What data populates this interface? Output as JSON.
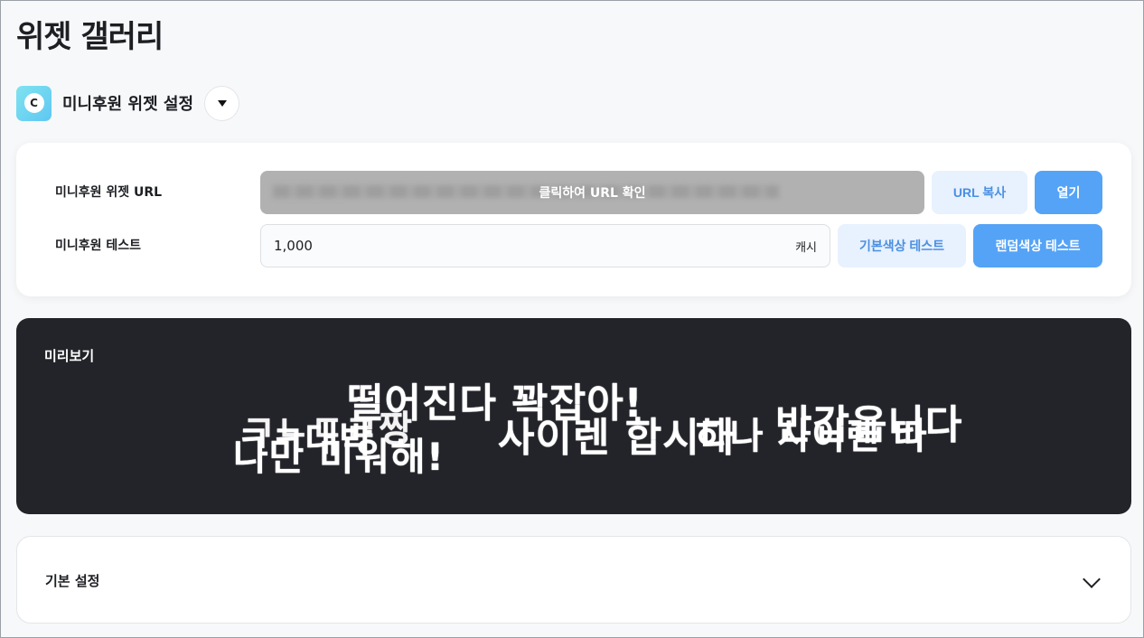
{
  "page": {
    "title": "위젯 갤러리"
  },
  "widget_selector": {
    "logo_letter": "C",
    "name": "미니후원 위젯 설정"
  },
  "settings_card": {
    "url_row": {
      "label": "미니후원 위젯 URL",
      "overlay_text": "클릭하여 URL 확인",
      "copy_label": "URL 복사",
      "open_label": "열기"
    },
    "test_row": {
      "label": "미니후원 테스트",
      "amount_value": "1,000",
      "unit": "캐시",
      "default_color_test_label": "기본색상 테스트",
      "random_color_test_label": "랜덤색상 테스트"
    }
  },
  "preview": {
    "title": "미리보기",
    "messages": [
      "떨어진다 꽉잡아!",
      "사이렌 합시다",
      "반갑읍니다",
      "ㅋㅋ대박",
      "ㄱㄴㄷㄹ짱",
      "나만 미워해!",
      "하나 사이렌 따"
    ]
  },
  "basic_settings": {
    "title": "기본 설정"
  },
  "colors": {
    "accent": "#55a3f6",
    "accent_light": "#e8f1fe",
    "preview_bg": "#222429"
  }
}
